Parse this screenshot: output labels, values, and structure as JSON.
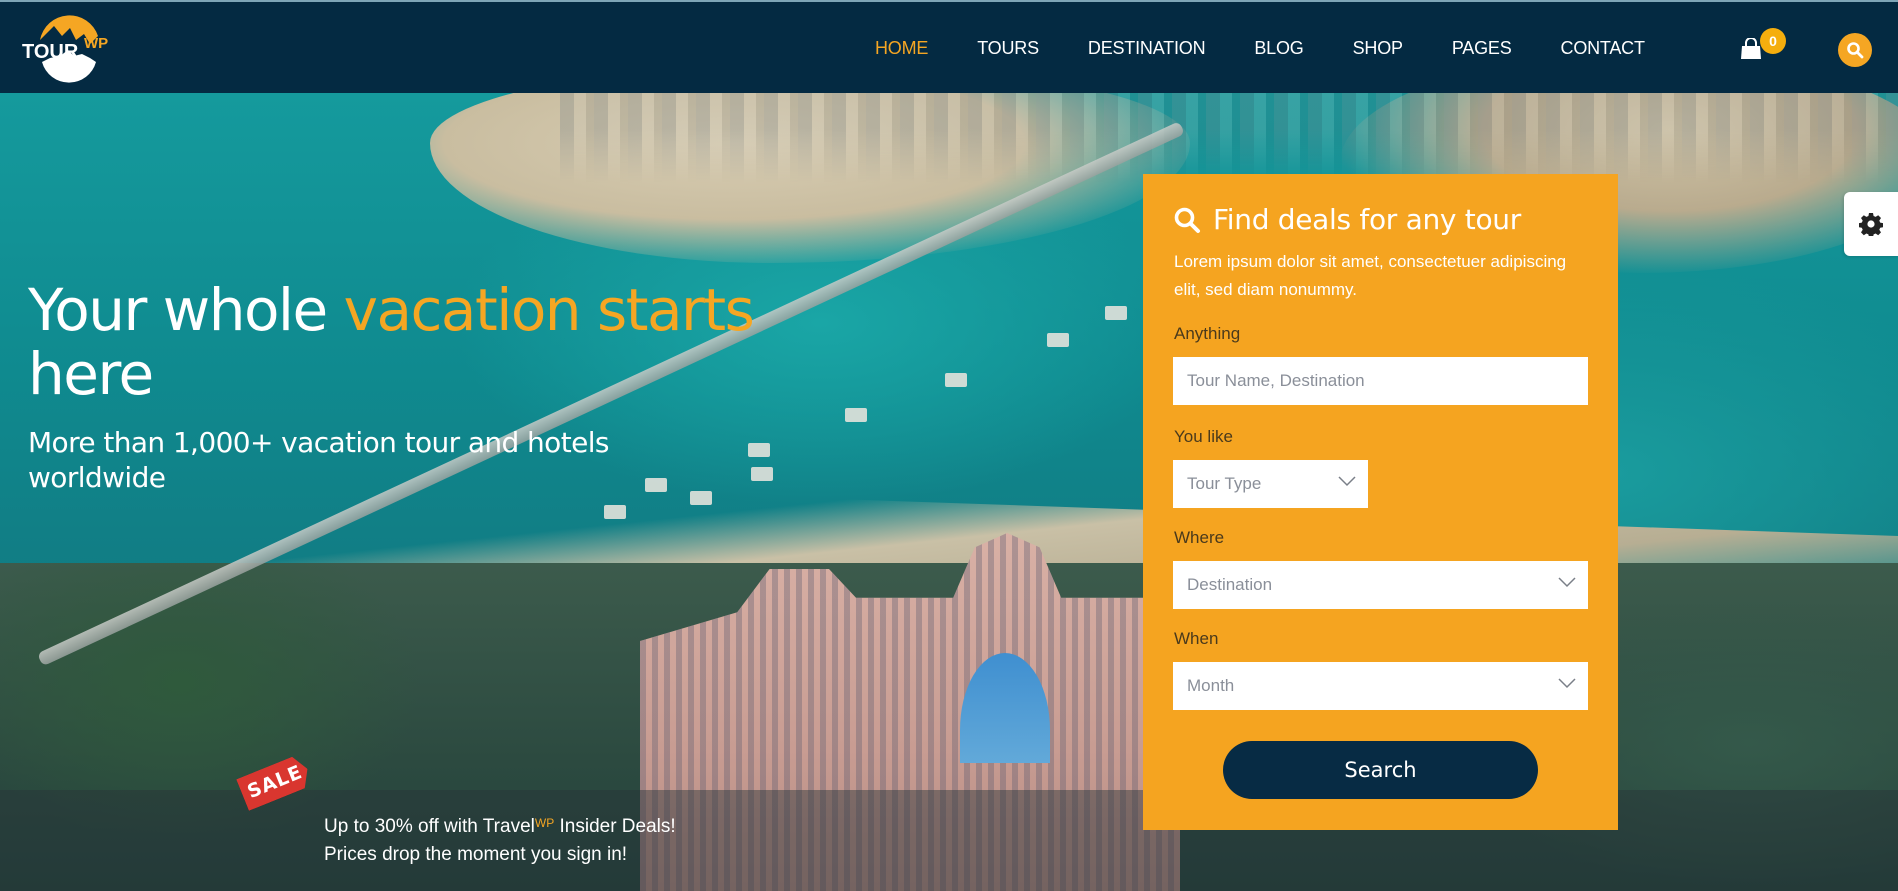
{
  "brand": {
    "logo_main": "TOUR",
    "logo_sup": "WP",
    "accent": "#f5a623",
    "header_bg": "#042a42"
  },
  "nav": {
    "items": [
      {
        "label": "HOME",
        "active": true
      },
      {
        "label": "TOURS",
        "active": false
      },
      {
        "label": "DESTINATION",
        "active": false
      },
      {
        "label": "BLOG",
        "active": false
      },
      {
        "label": "SHOP",
        "active": false
      },
      {
        "label": "PAGES",
        "active": false
      },
      {
        "label": "CONTACT",
        "active": false
      }
    ],
    "cart_icon": "shopping-bag-icon",
    "cart_count": "0",
    "search_icon": "search-icon"
  },
  "hero": {
    "title_plain": "Your whole ",
    "title_accent": "vacation starts",
    "title_end": "here",
    "subtitle": "More than 1,000+ vacation tour and hotels worldwide"
  },
  "promo": {
    "tag": "SALE",
    "line1_pre": "Up to 30% off with Travel",
    "line1_sup": "WP",
    "line1_post": " Insider Deals!",
    "line2": "Prices drop the moment you sign in!"
  },
  "search_panel": {
    "title": "Find deals for any tour",
    "description": "Lorem ipsum dolor sit amet, consectetuer adipiscing elit, sed diam nonummy.",
    "fields": {
      "anything": {
        "label": "Anything",
        "placeholder": "Tour Name, Destination",
        "value": ""
      },
      "you_like": {
        "label": "You like",
        "selected": "Tour Type"
      },
      "where": {
        "label": "Where",
        "selected": "Destination"
      },
      "when": {
        "label": "When",
        "selected": "Month"
      }
    },
    "submit_label": "Search",
    "bg_color": "#f5a420",
    "button_color": "#072b44"
  },
  "settings": {
    "icon": "gear-icon"
  }
}
